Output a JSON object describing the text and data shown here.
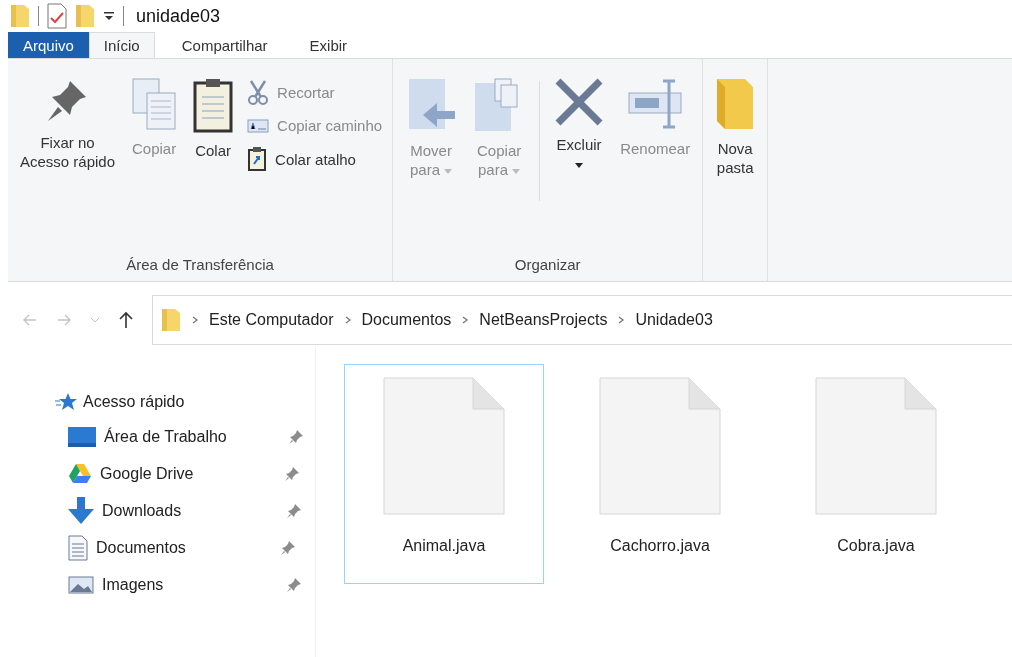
{
  "window": {
    "title": "unidade03"
  },
  "tabs": [
    {
      "label": "Arquivo",
      "kind": "file",
      "selected": false
    },
    {
      "label": "Início",
      "kind": "tab",
      "selected": true
    },
    {
      "label": "Compartilhar",
      "kind": "tab",
      "selected": false
    },
    {
      "label": "Exibir",
      "kind": "tab",
      "selected": false
    }
  ],
  "ribbon": {
    "groups": [
      {
        "label": "Área de Transferência",
        "items": [
          {
            "kind": "large",
            "label": "Fixar no\nAcesso rápido",
            "disabled": false,
            "has_menu": false
          },
          {
            "kind": "large",
            "label": "Copiar",
            "disabled": true,
            "has_menu": false
          },
          {
            "kind": "large",
            "label": "Colar",
            "disabled": false,
            "has_menu": false
          },
          {
            "kind": "small",
            "label": "Recortar",
            "disabled": true
          },
          {
            "kind": "small",
            "label": "Copiar caminho",
            "disabled": true
          },
          {
            "kind": "small",
            "label": "Colar atalho",
            "disabled": false
          }
        ]
      },
      {
        "label": "Organizar",
        "items": [
          {
            "kind": "large",
            "label": "Mover\npara",
            "disabled": true,
            "has_menu": true
          },
          {
            "kind": "large",
            "label": "Copiar\npara",
            "disabled": true,
            "has_menu": true
          },
          {
            "kind": "separator"
          },
          {
            "kind": "large",
            "label": "Excluir",
            "disabled": false,
            "has_menu": true
          },
          {
            "kind": "large",
            "label": "Renomear",
            "disabled": true,
            "has_menu": false
          }
        ]
      },
      {
        "items": [
          {
            "kind": "large",
            "label": "Nova\npasta",
            "disabled": false,
            "has_menu": false
          }
        ]
      }
    ]
  },
  "navigation": {
    "back_disabled": true,
    "forward_disabled": true,
    "up_disabled": false
  },
  "address": {
    "segments": [
      "Este Computador",
      "Documentos",
      "NetBeansProjects",
      "Unidade03"
    ]
  },
  "sidebar": {
    "heading": "Acesso rápido",
    "items": [
      {
        "label": "Área de Trabalho",
        "pinned": true
      },
      {
        "label": "Google Drive",
        "pinned": true
      },
      {
        "label": "Downloads",
        "pinned": true
      },
      {
        "label": "Documentos",
        "pinned": true
      },
      {
        "label": "Imagens",
        "pinned": true
      }
    ]
  },
  "files": [
    {
      "name": "Animal.java",
      "selected": true
    },
    {
      "name": "Cachorro.java",
      "selected": false
    },
    {
      "name": "Cobra.java",
      "selected": false
    }
  ]
}
